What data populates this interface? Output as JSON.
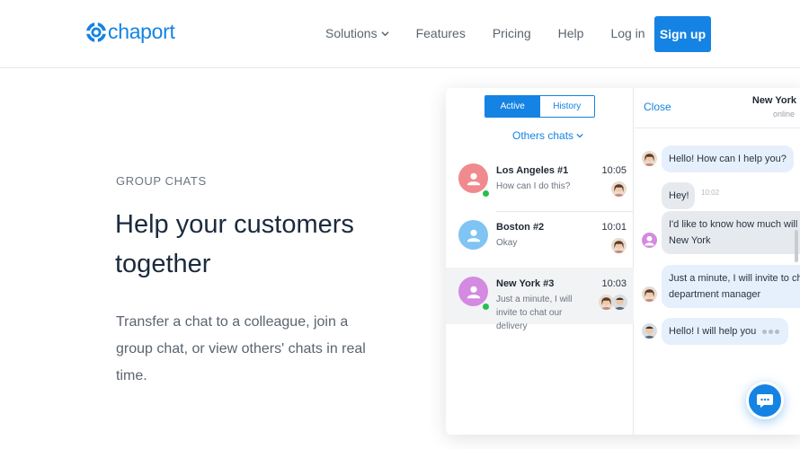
{
  "header": {
    "brand": "chaport",
    "nav": [
      {
        "label": "Solutions",
        "has_dropdown": true
      },
      {
        "label": "Features"
      },
      {
        "label": "Pricing"
      },
      {
        "label": "Help"
      },
      {
        "label": "Log in"
      }
    ],
    "signup_label": "Sign up"
  },
  "hero": {
    "eyebrow": "GROUP CHATS",
    "headline": "Help your customers together",
    "description": "Transfer a chat to a colleague, join a group chat, or view others' chats in real time."
  },
  "widget": {
    "tabs": [
      {
        "label": "Active",
        "selected": true
      },
      {
        "label": "History",
        "selected": false
      }
    ],
    "others_chats_label": "Others chats",
    "chats": [
      {
        "name": "Los Angeles #1",
        "time": "10:05",
        "message": "How can I do this?",
        "avatar_color": "#f08a8f",
        "selected": false
      },
      {
        "name": "Boston #2",
        "time": "10:01",
        "message": "Okay",
        "avatar_color": "#7fc4f2",
        "selected": false
      },
      {
        "name": "New York #3",
        "time": "10:03",
        "message": "Just a minute, I will invite to chat our delivery",
        "avatar_color": "#d38ae0",
        "selected": true
      }
    ],
    "conversation": {
      "close_label": "Close",
      "title": "New York",
      "status": "online",
      "messages": [
        {
          "text": "Hello! How can I help you?",
          "from": "operator-1"
        },
        {
          "text": "Hey!",
          "time": "10:02",
          "from": "visitor"
        },
        {
          "text": "I'd like to know how much will co",
          "text2": "New York",
          "from": "visitor"
        },
        {
          "text": "Just a minute, I will invite to chat",
          "text2": "department manager",
          "from": "operator-1"
        },
        {
          "text": "Hello! I will help you",
          "from": "operator-2",
          "typing": true
        }
      ]
    }
  },
  "colors": {
    "brand": "#1583e3",
    "online": "#25c04d",
    "visitor_avatar": "#d38ae0"
  }
}
